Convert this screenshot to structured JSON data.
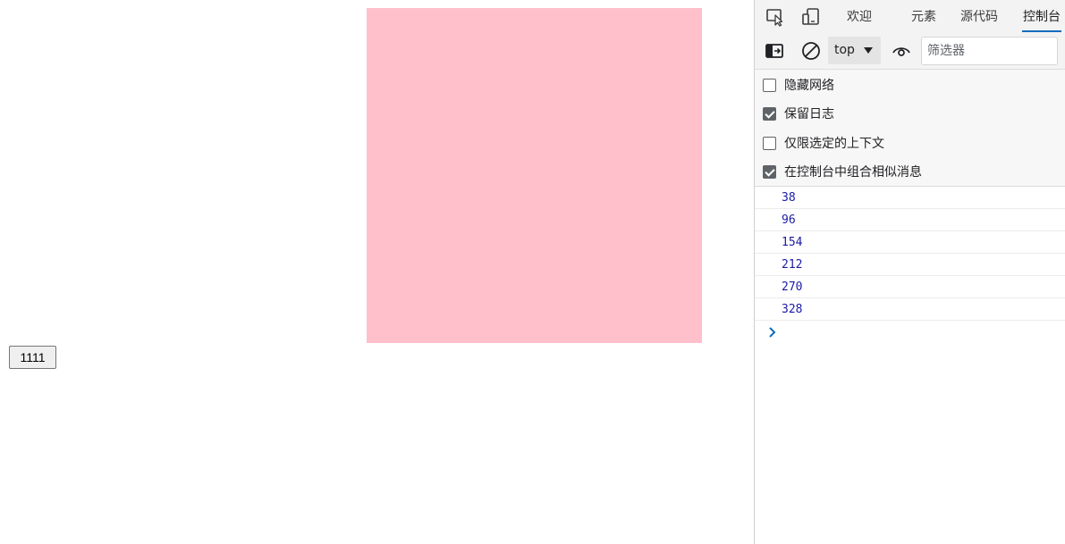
{
  "page": {
    "box_color": "#ffc0cb",
    "button_label": "1111"
  },
  "devtools": {
    "tabs": [
      {
        "label": "欢迎",
        "active": false
      },
      {
        "label": "元素",
        "active": false
      },
      {
        "label": "源代码",
        "active": false
      },
      {
        "label": "控制台",
        "active": true
      }
    ],
    "icons": {
      "inspect": "inspect-element-icon",
      "device": "device-emulation-icon",
      "sidebar": "sidebar-toggle-icon",
      "clear": "clear-console-icon",
      "eye": "live-expression-icon",
      "prompt": "chevron-right-icon"
    },
    "toolbar": {
      "context": "top",
      "filter_placeholder": "筛选器"
    },
    "settings": [
      {
        "label": "隐藏网络",
        "checked": false
      },
      {
        "label": "保留日志",
        "checked": true
      },
      {
        "label": "仅限选定的上下文",
        "checked": false
      },
      {
        "label": "在控制台中组合相似消息",
        "checked": true
      }
    ],
    "logs": [
      "38",
      "96",
      "154",
      "212",
      "270",
      "328"
    ],
    "accent_color": "#0f6cbd",
    "log_color": "#1a1aa6"
  }
}
